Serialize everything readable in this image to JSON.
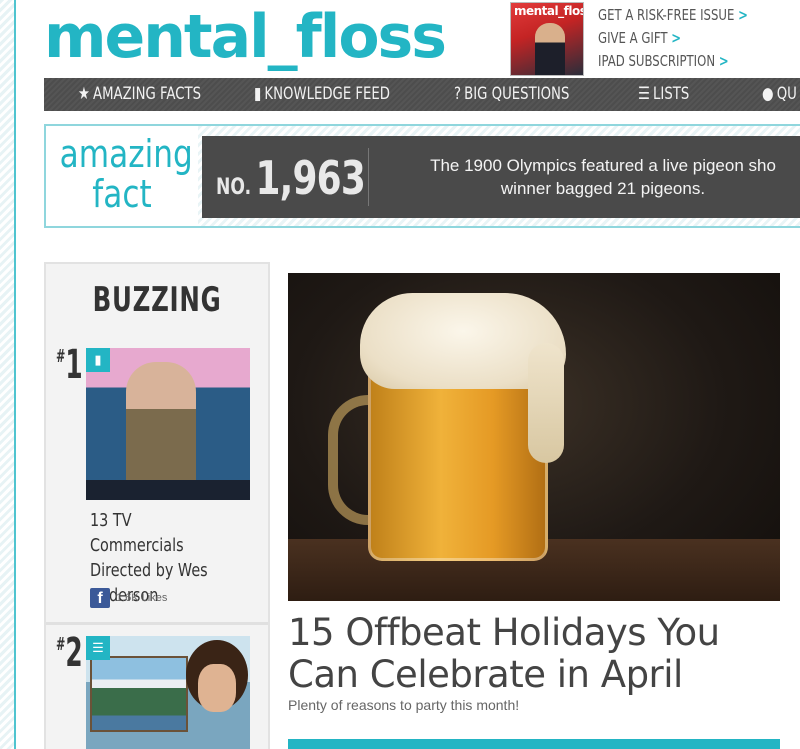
{
  "header": {
    "logo": "mental_floss",
    "magazine_cover_title": "mental_floss",
    "links": [
      {
        "label": "GET A RISK-FREE ISSUE",
        "chevron": ">"
      },
      {
        "label": "GIVE A GIFT",
        "chevron": ">"
      },
      {
        "label": "IPAD SUBSCRIPTION",
        "chevron": ">"
      }
    ]
  },
  "nav": {
    "items": [
      {
        "icon": "★",
        "label": "AMAZING FACTS"
      },
      {
        "icon": "▮",
        "label": "KNOWLEDGE FEED"
      },
      {
        "icon": "?",
        "label": "BIG QUESTIONS"
      },
      {
        "icon": "☰",
        "label": "LISTS"
      },
      {
        "icon": "●",
        "label": "QU"
      }
    ]
  },
  "fact": {
    "label_line1": "amazing",
    "label_line2": "fact",
    "no_prefix": "NO.",
    "number": "1,963",
    "text_line1": "The 1900 Olympics featured a live pigeon sho",
    "text_line2": "winner bagged 21 pigeons."
  },
  "buzzing": {
    "title": "BUZZING",
    "items": [
      {
        "rank_hash": "#",
        "rank": "1",
        "badge": "▮",
        "title": "13 TV Commercials Directed by Wes Anderson",
        "likes": "1.6K Likes"
      },
      {
        "rank_hash": "#",
        "rank": "2",
        "badge": "☰"
      }
    ]
  },
  "feature": {
    "title": "15 Offbeat Holidays You Can Celebrate in April",
    "subtitle": "Plenty of reasons to party this month!"
  },
  "colors": {
    "brand": "#23b5c4",
    "nav_bg": "#4d4d4d",
    "fact_dark": "#4a4a4a",
    "facebook": "#3b5998"
  }
}
